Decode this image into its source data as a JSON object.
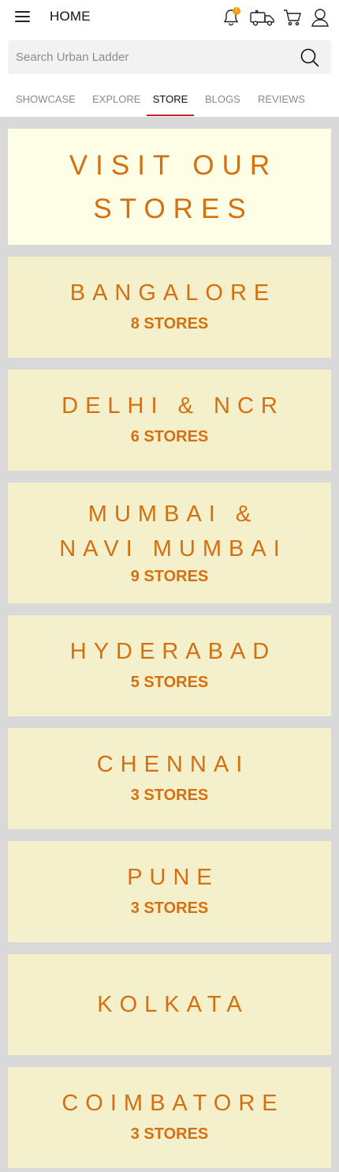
{
  "header": {
    "title": "HOME",
    "notification_count": "!",
    "accent_color": "#f39c12"
  },
  "search": {
    "placeholder": "Search Urban Ladder"
  },
  "tabs": [
    {
      "label": "SHOWCASE"
    },
    {
      "label": "EXPLORE"
    },
    {
      "label": "STORE"
    },
    {
      "label": "BLOGS"
    },
    {
      "label": "REVIEWS"
    }
  ],
  "active_tab": "STORE",
  "hero": {
    "title": "VISIT OUR STORES"
  },
  "cities": [
    {
      "name": "BANGALORE",
      "count": "8 STORES"
    },
    {
      "name": "DELHI & NCR",
      "count": "6 STORES"
    },
    {
      "name": "MUMBAI & NAVI MUMBAI",
      "count": "9 STORES"
    },
    {
      "name": "HYDERABAD",
      "count": "5 STORES"
    },
    {
      "name": "CHENNAI",
      "count": "3 STORES"
    },
    {
      "name": "PUNE",
      "count": "3 STORES"
    },
    {
      "name": "KOLKATA",
      "count": ""
    },
    {
      "name": "COIMBATORE",
      "count": "3 STORES"
    }
  ],
  "colors": {
    "brand_orange": "#d4700f",
    "tab_underline": "#c62828",
    "card_bg": "#f4f0cb",
    "hero_bg": "#fefee6"
  }
}
